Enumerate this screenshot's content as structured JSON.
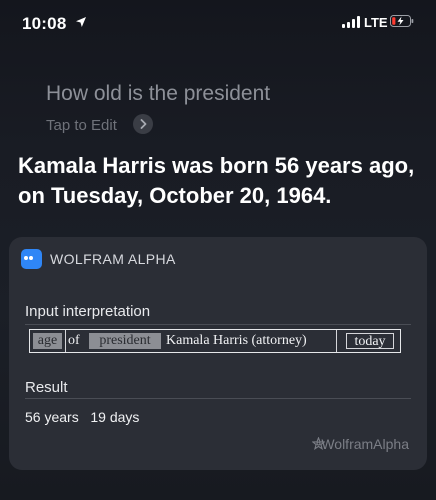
{
  "status_bar": {
    "time": "10:08",
    "carrier": "LTE",
    "icons": [
      "location-arrow-icon",
      "cellular-signal-icon",
      "battery-charging-icon"
    ],
    "battery_color": "#ff3b30"
  },
  "query": {
    "text": "How old is the president",
    "edit_label": "Tap to Edit"
  },
  "answer": {
    "text": "Kamala Harris was born 56 years ago, on Tuesday, October 20, 1964."
  },
  "card": {
    "source": "WOLFRAM ALPHA",
    "source_color": "#2f86f6",
    "input_interpretation": {
      "label": "Input interpretation",
      "segments": {
        "age": "age",
        "of": "of",
        "president": "president",
        "name": "Kamala Harris  (attorney)",
        "today": "today"
      }
    },
    "result": {
      "label": "Result",
      "value": "56 years   19 days"
    },
    "footer": "WolframAlpha"
  }
}
